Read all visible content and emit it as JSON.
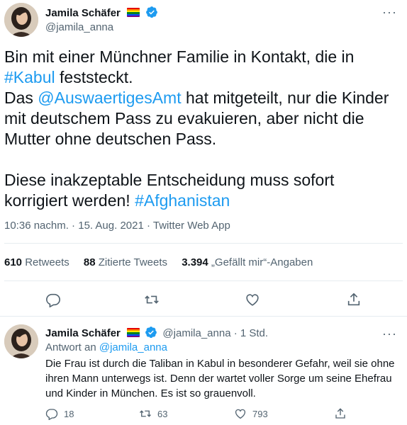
{
  "tweet": {
    "author": {
      "name": "Jamila Schäfer",
      "handle": "@jamila_anna",
      "avatar_icon": "avatar-photo",
      "badges": [
        "rainbow-flag-icon",
        "verified-icon"
      ]
    },
    "more_icon": "more-icon",
    "more_label": "···",
    "text": {
      "line1": "Bin mit einer Münchner Familie in Kontakt, die in",
      "hashtag_kabul": "#Kabul",
      "line2_rest": " feststeckt.",
      "line3_start": "Das ",
      "mention_amt": "@AuswaertigesAmt",
      "line3_rest": " hat mitgeteilt, nur die Kinder mit deutschem Pass zu evakuieren, aber nicht die Mutter ohne deutschen Pass.",
      "para2": "Diese inakzeptable Entscheidung muss sofort korrigiert werden! ",
      "hashtag_afg": "#Afghanistan"
    },
    "timestamp": "10:36 nachm. · 15. Aug. 2021 · Twitter Web App",
    "stats": {
      "retweets_count": "610",
      "retweets_label": "Retweets",
      "quotes_count": "88",
      "quotes_label": "Zitierte Tweets",
      "likes_count": "3.394",
      "likes_label": "„Gefällt mir“-Angaben"
    },
    "actions": [
      "reply-icon",
      "retweet-icon",
      "like-icon",
      "share-icon"
    ]
  },
  "reply": {
    "author": {
      "name": "Jamila Schäfer",
      "handle_time": "@jamila_anna · 1 Std."
    },
    "reply_to_label": "Antwort an ",
    "reply_to_handle": "@jamila_anna",
    "text": "Die Frau ist durch die Taliban in Kabul in besonderer Gefahr, weil sie ohne ihren Mann unterwegs ist. Denn der wartet voller Sorge um seine Ehefrau und Kinder in München. Es ist so grauenvoll.",
    "counts": {
      "replies": "18",
      "retweets": "63",
      "likes": "793"
    }
  },
  "colors": {
    "link": "#1d9bf0",
    "muted": "#536471",
    "text": "#0f1419",
    "divider": "#e6ecf0"
  }
}
